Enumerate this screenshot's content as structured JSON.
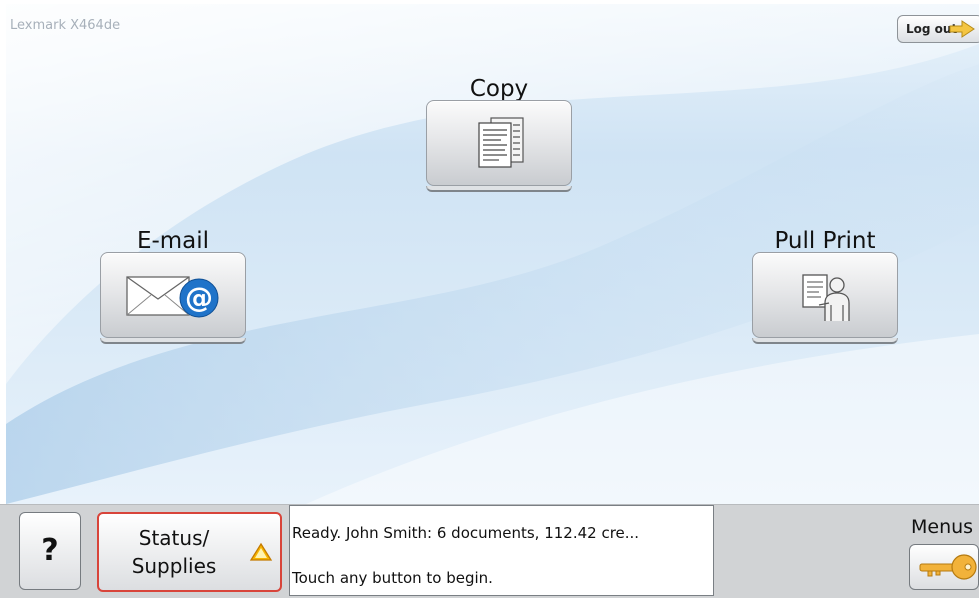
{
  "header": {
    "model": "Lexmark X464de",
    "logout_label": "Log out"
  },
  "tiles": {
    "copy": {
      "label": "Copy"
    },
    "email": {
      "label": "E-mail"
    },
    "pull_print": {
      "label": "Pull Print"
    }
  },
  "footer": {
    "help_label": "?",
    "status_line1": "Status/",
    "status_line2": "Supplies",
    "message_line1": "Ready. John Smith: 6 documents, 112.42 cre...",
    "message_line2": "Touch any button to begin.",
    "menus_label": "Menus"
  },
  "colors": {
    "status_border": "#d8443a",
    "warning_triangle": "#f6b400",
    "email_at": "#1f73c9",
    "key": "#f2b23a"
  }
}
